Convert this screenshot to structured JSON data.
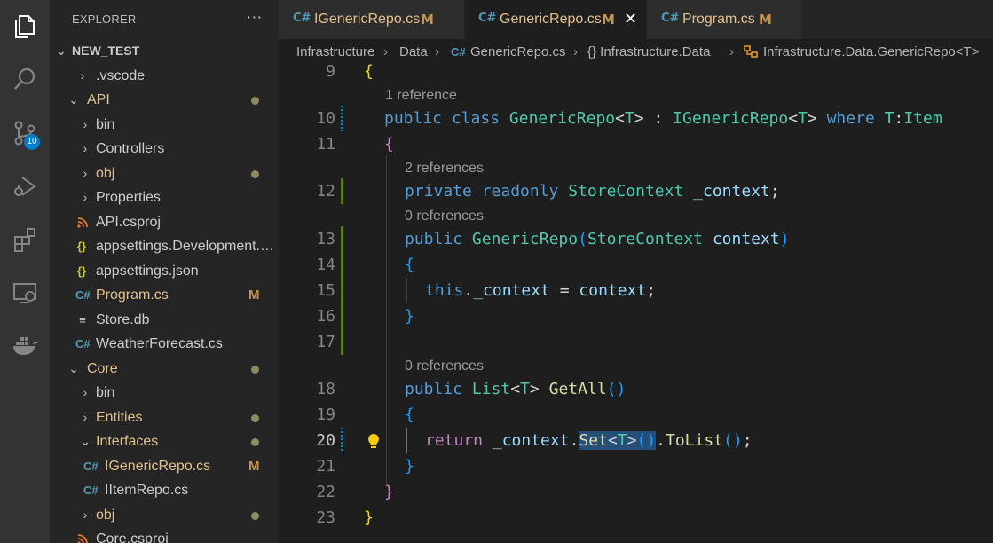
{
  "activity_bar": {
    "icons": [
      "files-icon",
      "search-icon",
      "source-control-icon",
      "run-debug-icon",
      "extensions-icon",
      "remote-explorer-icon",
      "docker-icon"
    ],
    "scm_badge": "10"
  },
  "explorer": {
    "title": "EXPLORER",
    "more": "···",
    "root": "NEW_TEST",
    "items": [
      {
        "label": ".vscode"
      },
      {
        "label": "API"
      },
      {
        "label": "bin"
      },
      {
        "label": "Controllers"
      },
      {
        "label": "obj"
      },
      {
        "label": "Properties"
      },
      {
        "label": "API.csproj"
      },
      {
        "label": "appsettings.Development.json"
      },
      {
        "label": "appsettings.json"
      },
      {
        "label": "Program.cs",
        "badge": "M"
      },
      {
        "label": "Store.db"
      },
      {
        "label": "WeatherForecast.cs"
      },
      {
        "label": "Core"
      },
      {
        "label": "bin"
      },
      {
        "label": "Entities"
      },
      {
        "label": "Interfaces"
      },
      {
        "label": "IGenericRepo.cs",
        "badge": "M"
      },
      {
        "label": "IItemRepo.cs"
      },
      {
        "label": "obj"
      },
      {
        "label": "Core.csproj"
      }
    ]
  },
  "tabs": [
    {
      "label": "IGenericRepo.cs",
      "badge": "M"
    },
    {
      "label": "GenericRepo.cs",
      "badge": "M",
      "close": "✕"
    },
    {
      "label": "Program.cs",
      "badge": "M"
    }
  ],
  "breadcrumb": [
    "Infrastructure",
    "Data",
    "GenericRepo.cs",
    "{} Infrastructure.Data",
    "Infrastructure.Data.GenericRepo<T>"
  ],
  "editor": {
    "line_numbers": [
      "9",
      "10",
      "11",
      "12",
      "13",
      "14",
      "15",
      "16",
      "17",
      "18",
      "19",
      "20",
      "21",
      "22",
      "23"
    ],
    "code_lens": [
      "1 reference",
      "2 references",
      "0 references",
      "0 references"
    ],
    "code": {
      "l9": "{",
      "l10_public": "public",
      "l10_class": "class",
      "l10_name": "GenericRepo",
      "l10_lt": "<",
      "l10_T": "T",
      "l10_gt": ">",
      "l10_colon": " : ",
      "l10_iface": "IGenericRepo",
      "l10_where": "where",
      "l10_T2": "T",
      "l10_colon2": ":",
      "l10_item": "Item",
      "l11": "{",
      "l12_private": "private",
      "l12_readonly": "readonly",
      "l12_type": "StoreContext",
      "l12_field": "_context",
      "l12_semi": ";",
      "l13_public": "public",
      "l13_name": "GenericRepo",
      "l13_open": "(",
      "l13_type": "StoreContext",
      "l13_param": "context",
      "l13_close": ")",
      "l14": "{",
      "l15_this": "this",
      "l15_dot": ".",
      "l15_field": "_context",
      "l15_eq": " = ",
      "l15_param": "context",
      "l15_semi": ";",
      "l16": "}",
      "l18_public": "public",
      "l18_list": "List",
      "l18_lt": "<",
      "l18_T": "T",
      "l18_gt": ">",
      "l18_name": "GetAll",
      "l18_parens": "()",
      "l19": "{",
      "l20_return": "return",
      "l20_field": "_context",
      "l20_dot": ".",
      "l20_set": "Set",
      "l20_lt": "<",
      "l20_T": "T",
      "l20_gt": ">",
      "l20_parens": "()",
      "l20_dot2": ".",
      "l20_tolist": "ToList",
      "l20_parens2": "()",
      "l20_semi": ";",
      "l21": "}",
      "l22": "}",
      "l23": "}"
    }
  }
}
